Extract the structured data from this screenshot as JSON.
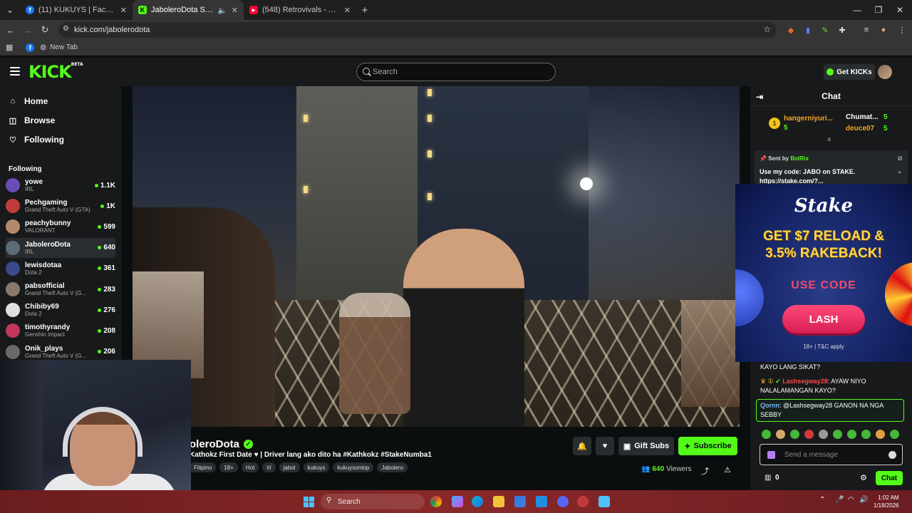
{
  "browser": {
    "tabs": [
      {
        "title": "(11) KUKUYS | Facebook",
        "favicon": "f",
        "color": "#1877f2"
      },
      {
        "title": "JaboleroDota Stream - Watch",
        "favicon": "K",
        "color": "#53fc18"
      },
      {
        "title": "(548) Retrovivals - Araw-Gabi -",
        "favicon": "▶",
        "color": "#ff0033"
      }
    ],
    "new_tab": "+",
    "url": "kick.com/jabolerodota",
    "bookmark": "New Tab"
  },
  "header": {
    "logo": "KICK",
    "logo_beta": "BETA",
    "search_placeholder": "Search",
    "get_kicks": "Get KICKs"
  },
  "sidebar": {
    "nav": [
      {
        "label": "Home",
        "icon": "home-icon",
        "glyph": "⌂"
      },
      {
        "label": "Browse",
        "icon": "browse-icon",
        "glyph": "◫"
      },
      {
        "label": "Following",
        "icon": "heart-icon",
        "glyph": "♡"
      }
    ],
    "following_title": "Following",
    "channels": [
      {
        "name": "yowe",
        "category": "IRL",
        "viewers": "1.1K",
        "color": "#6b4bb5"
      },
      {
        "name": "Pechgaming",
        "category": "Grand Theft Auto V (GTA)",
        "viewers": "1K",
        "color": "#c23b3b"
      },
      {
        "name": "peachybunny",
        "category": "VALORANT",
        "viewers": "599",
        "color": "#b58a6b"
      },
      {
        "name": "JaboleroDota",
        "category": "IRL",
        "viewers": "640",
        "color": "#5a6b7a"
      },
      {
        "name": "lewisdotaa",
        "category": "Dota 2",
        "viewers": "361",
        "color": "#3a4a8a"
      },
      {
        "name": "pabsofficial",
        "category": "Grand Theft Auto V (G...",
        "viewers": "283",
        "color": "#8a7a6b"
      },
      {
        "name": "Chibiby69",
        "category": "Dota 2",
        "viewers": "276",
        "color": "#e0e0e0"
      },
      {
        "name": "timothyrandy",
        "category": "Genshin Impact",
        "viewers": "208",
        "color": "#c2375a"
      },
      {
        "name": "Onik_plays",
        "category": "Grand Theft Auto V (G...",
        "viewers": "206",
        "color": "#6a6a6a"
      }
    ]
  },
  "stream": {
    "streamer": "oleroDota",
    "title": "Kathokz First Date ♥ | Driver lang ako dito ha #Kathkokz #StakeNumba1",
    "tags": [
      "Filipino",
      "18+",
      "Hot",
      "irl",
      "jabol",
      "kukuys",
      "kukuysontop",
      "Jabolero"
    ],
    "gift_subs": "Gift Subs",
    "subscribe": "Subscribe",
    "viewers": "640",
    "viewers_label": "Viewers"
  },
  "chat": {
    "title": "Chat",
    "gifters": [
      {
        "name": "hangerniyuri...",
        "count": "5",
        "color": "#f5a623"
      },
      {
        "name": "Chumat...",
        "count": "5",
        "color": "#ffffff"
      },
      {
        "name": "deuce07",
        "count": "5",
        "color": "#f5a623"
      }
    ],
    "rank": "1",
    "pinned": {
      "sent_by": "Sent by",
      "bot": "BotRix",
      "message": "Use my code: JABO on STAKE.",
      "link": "https://stake.com/?..."
    },
    "ad": {
      "brand": "Stake",
      "offer_line1": "GET $7 RELOAD &",
      "offer_line2": "3.5% RAKEBACK!",
      "use_code": "USE CODE",
      "code": "LASH",
      "tnc": "18+ | T&C apply"
    },
    "messages": [
      {
        "user": "",
        "text": "KAYO LANG SIKAT?",
        "color": "#ffffff"
      },
      {
        "user": "Lashsegway28",
        "text": ": AYAW NIYO NALALAMANGAN KAYO?",
        "color": "#ff4a4a"
      },
      {
        "user": "Qornn",
        "text": ": @Lashsegway28 GANON NA NGA SEBBY",
        "color": "#7ab8ff"
      }
    ],
    "input_placeholder": "Send a message",
    "points": "0",
    "send": "Chat"
  },
  "taskbar": {
    "search": "Search",
    "time": "1:02 AM",
    "date": "1/18/2026"
  }
}
